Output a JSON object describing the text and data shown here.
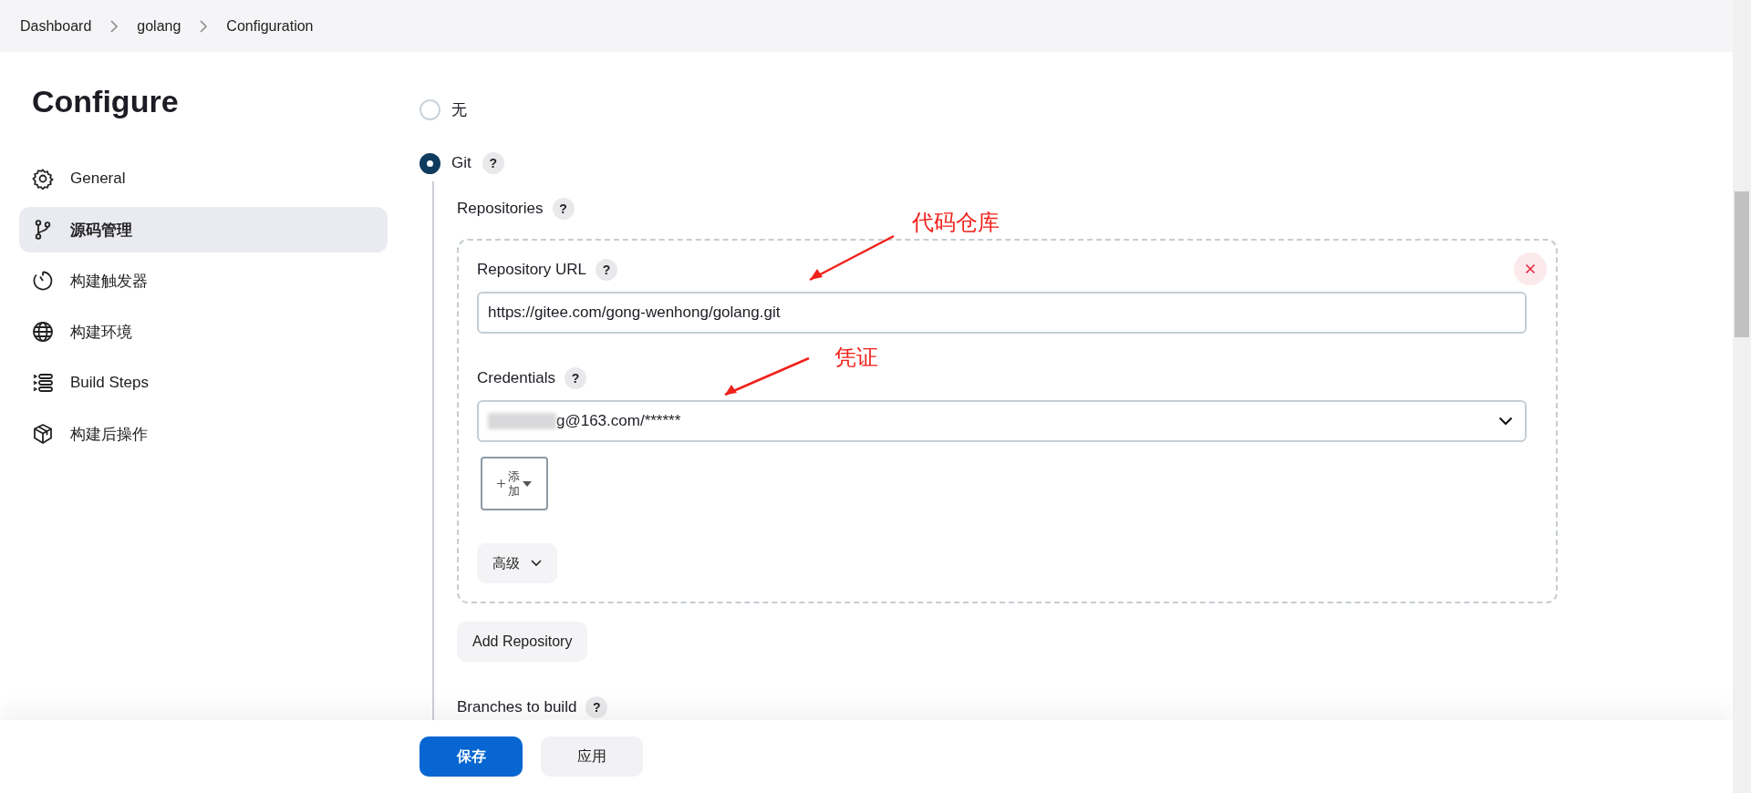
{
  "breadcrumb": [
    {
      "label": "Dashboard"
    },
    {
      "label": "golang"
    },
    {
      "label": "Configuration"
    }
  ],
  "page_title": "Configure",
  "sidebar": {
    "items": [
      {
        "label": "General",
        "selected": false
      },
      {
        "label": "源码管理",
        "selected": true
      },
      {
        "label": "构建触发器",
        "selected": false
      },
      {
        "label": "构建环境",
        "selected": false
      },
      {
        "label": "Build Steps",
        "selected": false
      },
      {
        "label": "构建后操作",
        "selected": false
      }
    ]
  },
  "scm_options": [
    {
      "label": "无",
      "selected": false
    },
    {
      "label": "Git",
      "selected": true,
      "help": "?"
    }
  ],
  "repositories": {
    "label": "Repositories",
    "help": "?",
    "entries": [
      {
        "close": true,
        "url_label": "Repository URL",
        "url_help": "?",
        "url": "https://gitee.com/gong-wenhong/golang.git",
        "credentials_label": "Credentials",
        "credentials_help": "?",
        "credentials": "g@163.com/******",
        "credentials_blurred": true,
        "add_button": "添加",
        "advanced_button": "高级"
      }
    ],
    "add_button": "Add Repository"
  },
  "branches": {
    "label": "Branches to build",
    "help": "?"
  },
  "annotations": [
    {
      "text": "代码仓库"
    },
    {
      "text": "凭证"
    }
  ],
  "footer_buttons": [
    {
      "label": "保存",
      "kind": "primary"
    },
    {
      "label": "应用",
      "kind": "secondary"
    }
  ]
}
